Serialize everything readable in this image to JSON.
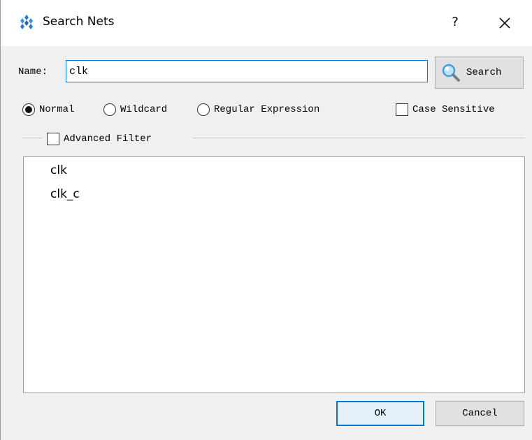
{
  "window": {
    "title": "Search Nets",
    "help_label": "?",
    "close_icon": "close-icon",
    "app_icon": "gowin-logo-icon"
  },
  "search": {
    "name_label": "Name:",
    "name_value": "clk",
    "search_button_label": "Search",
    "search_icon": "magnifier-icon"
  },
  "match_mode": {
    "options": [
      {
        "label": "Normal",
        "checked": true
      },
      {
        "label": "Wildcard",
        "checked": false
      },
      {
        "label": "Regular Expression",
        "checked": false
      }
    ],
    "case_sensitive_label": "Case Sensitive",
    "case_sensitive_checked": false
  },
  "advanced_filter": {
    "label": "Advanced Filter",
    "checked": false
  },
  "results": [
    "clk",
    "clk_c"
  ],
  "buttons": {
    "ok_label": "OK",
    "cancel_label": "Cancel"
  },
  "colors": {
    "accent": "#0078d7",
    "dialog_bg": "#f0f0f0"
  }
}
